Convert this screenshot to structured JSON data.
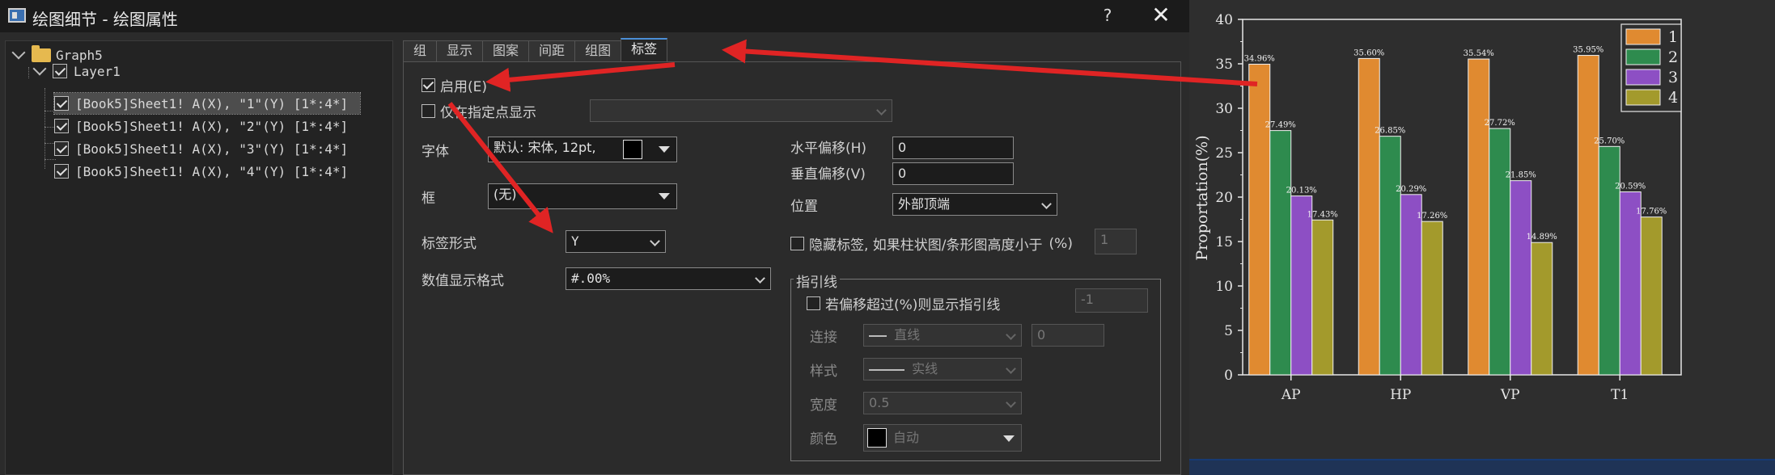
{
  "window": {
    "title": "绘图细节 - 绘图属性",
    "help_label": "?",
    "close_label": "✕"
  },
  "tree": {
    "root": "Graph5",
    "layer": "Layer1",
    "plots": [
      "[Book5]Sheet1! A(X), \"1\"(Y) [1*:4*]",
      "[Book5]Sheet1! A(X), \"2\"(Y) [1*:4*]",
      "[Book5]Sheet1! A(X), \"3\"(Y) [1*:4*]",
      "[Book5]Sheet1! A(X), \"4\"(Y) [1*:4*]"
    ]
  },
  "tabs": [
    "组",
    "显示",
    "图案",
    "间距",
    "组图",
    "标签"
  ],
  "active_tab": "标签",
  "labels_tab": {
    "enable": {
      "label": "启用(E)",
      "checked": true
    },
    "only_points": {
      "label": "仅在指定点显示",
      "checked": false,
      "value": ""
    },
    "font": {
      "label": "字体",
      "value": "默认: 宋体, 12pt,",
      "color": "#000000"
    },
    "frame": {
      "label": "框",
      "value": "(无)"
    },
    "label_form": {
      "label": "标签形式",
      "value": "Y"
    },
    "num_format": {
      "label": "数值显示格式",
      "value": "#.00%"
    },
    "h_offset": {
      "label": "水平偏移(H)",
      "value": "0"
    },
    "v_offset": {
      "label": "垂直偏移(V)",
      "value": "0"
    },
    "position": {
      "label": "位置",
      "value": "外部顶端"
    },
    "hide_label": {
      "label": "隐藏标签, 如果柱状图/条形图高度小于",
      "unit": "(%)",
      "value": "1",
      "checked": false
    },
    "leader": {
      "legend": "指引线",
      "show": {
        "label": "若偏移超过(%)则显示指引线",
        "value": "-1",
        "checked": false
      },
      "connect": {
        "label": "连接",
        "value": "直线",
        "extra": "0"
      },
      "style": {
        "label": "样式",
        "value": "实线"
      },
      "width": {
        "label": "宽度",
        "value": "0.5"
      },
      "color": {
        "label": "颜色",
        "value": "自动"
      }
    }
  },
  "chart_data": {
    "type": "bar",
    "categories": [
      "AP",
      "HP",
      "VP",
      "T1"
    ],
    "series": [
      {
        "name": "1",
        "color": "#e08a30",
        "values": [
          34.96,
          35.6,
          35.54,
          35.95
        ],
        "labels": [
          "34.96%",
          "35.60%",
          "35.54%",
          "35.95%"
        ]
      },
      {
        "name": "2",
        "color": "#2e8b4e",
        "values": [
          27.49,
          26.85,
          27.72,
          25.7
        ],
        "labels": [
          "27.49%",
          "26.85%",
          "27.72%",
          "25.70%"
        ]
      },
      {
        "name": "3",
        "color": "#8d4fc4",
        "values": [
          20.13,
          20.29,
          21.85,
          20.59
        ],
        "labels": [
          "20.13%",
          "20.29%",
          "21.85%",
          "20.59%"
        ]
      },
      {
        "name": "4",
        "color": "#a39a2c",
        "values": [
          17.43,
          17.26,
          14.89,
          17.76
        ],
        "labels": [
          "17.43%",
          "17.26%",
          "14.89%",
          "17.76%"
        ]
      }
    ],
    "xlabel": "",
    "ylabel": "Proportation(%)",
    "ylim": [
      0,
      40
    ],
    "yticks": [
      "0",
      "5",
      "10",
      "15",
      "20",
      "25",
      "30",
      "35",
      "40"
    ],
    "legend_position": "top-right",
    "grid": false
  },
  "annotation_color": "#e02424"
}
